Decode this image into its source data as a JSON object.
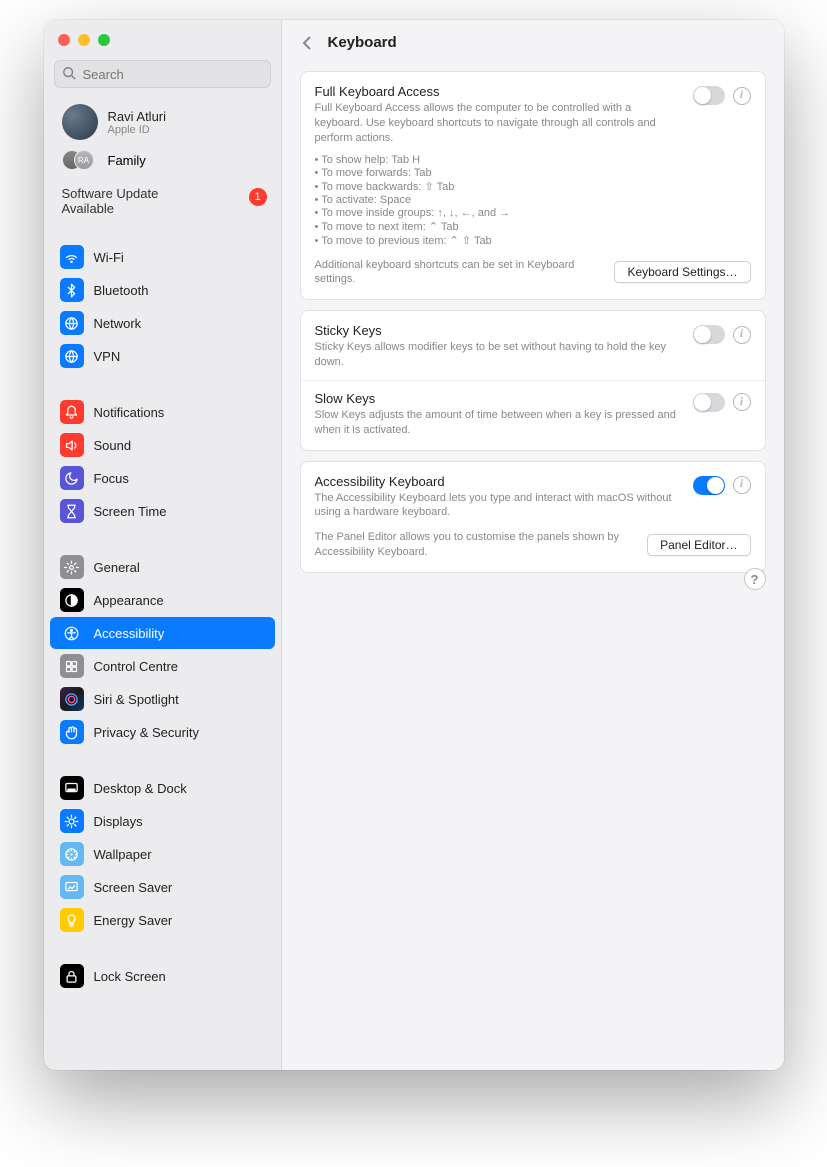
{
  "search": {
    "placeholder": "Search"
  },
  "profile": {
    "name": "Ravi Atluri",
    "sub": "Apple ID"
  },
  "family": {
    "label": "Family"
  },
  "update": {
    "line1": "Software Update",
    "line2": "Available",
    "badge": "1"
  },
  "sidebar": {
    "items": [
      {
        "icon": "wifi",
        "cls": "i-blue",
        "label": "Wi-Fi"
      },
      {
        "icon": "bt",
        "cls": "i-blue",
        "label": "Bluetooth"
      },
      {
        "icon": "globe",
        "cls": "i-blue",
        "label": "Network"
      },
      {
        "icon": "globe",
        "cls": "i-blue",
        "label": "VPN"
      }
    ],
    "items2": [
      {
        "icon": "bell",
        "cls": "i-red",
        "label": "Notifications"
      },
      {
        "icon": "sound",
        "cls": "i-red",
        "label": "Sound"
      },
      {
        "icon": "moon",
        "cls": "i-purpl",
        "label": "Focus"
      },
      {
        "icon": "hour",
        "cls": "i-purpl",
        "label": "Screen Time"
      }
    ],
    "items3": [
      {
        "icon": "gear",
        "cls": "i-grey",
        "label": "General"
      },
      {
        "icon": "appear",
        "cls": "i-black",
        "label": "Appearance"
      },
      {
        "icon": "access",
        "cls": "i-blue",
        "label": "Accessibility",
        "selected": true
      },
      {
        "icon": "ctrl",
        "cls": "i-grey",
        "label": "Control Centre"
      },
      {
        "icon": "siri",
        "cls": "i-siri",
        "label": "Siri & Spotlight"
      },
      {
        "icon": "hand",
        "cls": "i-blue",
        "label": "Privacy & Security"
      }
    ],
    "items4": [
      {
        "icon": "dock",
        "cls": "i-black",
        "label": "Desktop & Dock"
      },
      {
        "icon": "disp",
        "cls": "i-blue",
        "label": "Displays"
      },
      {
        "icon": "wall",
        "cls": "i-lblue",
        "label": "Wallpaper"
      },
      {
        "icon": "scrn",
        "cls": "i-lblue",
        "label": "Screen Saver"
      },
      {
        "icon": "bulb",
        "cls": "i-yellow",
        "label": "Energy Saver"
      }
    ],
    "items5": [
      {
        "icon": "lock",
        "cls": "i-black",
        "label": "Lock Screen"
      }
    ]
  },
  "header": {
    "title": "Keyboard"
  },
  "fullkb": {
    "title": "Full Keyboard Access",
    "desc": "Full Keyboard Access allows the computer to be controlled with a keyboard. Use keyboard shortcuts to navigate through all controls and perform actions.",
    "b1": "• To show help: Tab H",
    "b2": "• To move forwards: Tab",
    "b3": "• To move backwards: ⇧ Tab",
    "b4": "• To activate: Space",
    "b5": "• To move inside groups: ↑, ↓, ←, and →",
    "b6": "• To move to next item: ⌃ Tab",
    "b7": "• To move to previous item: ⌃ ⇧ Tab",
    "bottom": "Additional keyboard shortcuts can be set in Keyboard settings.",
    "btn": "Keyboard Settings…"
  },
  "sticky": {
    "title": "Sticky Keys",
    "desc": "Sticky Keys allows modifier keys to be set without having to hold the key down."
  },
  "slow": {
    "title": "Slow Keys",
    "desc": "Slow Keys adjusts the amount of time between when a key is pressed and when it is activated."
  },
  "accesskb": {
    "title": "Accessibility Keyboard",
    "desc": "The Accessibility Keyboard lets you type and interact with macOS without using a hardware keyboard.",
    "bottom": "The Panel Editor allows you to customise the panels shown by Accessibility Keyboard.",
    "btn": "Panel Editor…"
  },
  "help": "?"
}
